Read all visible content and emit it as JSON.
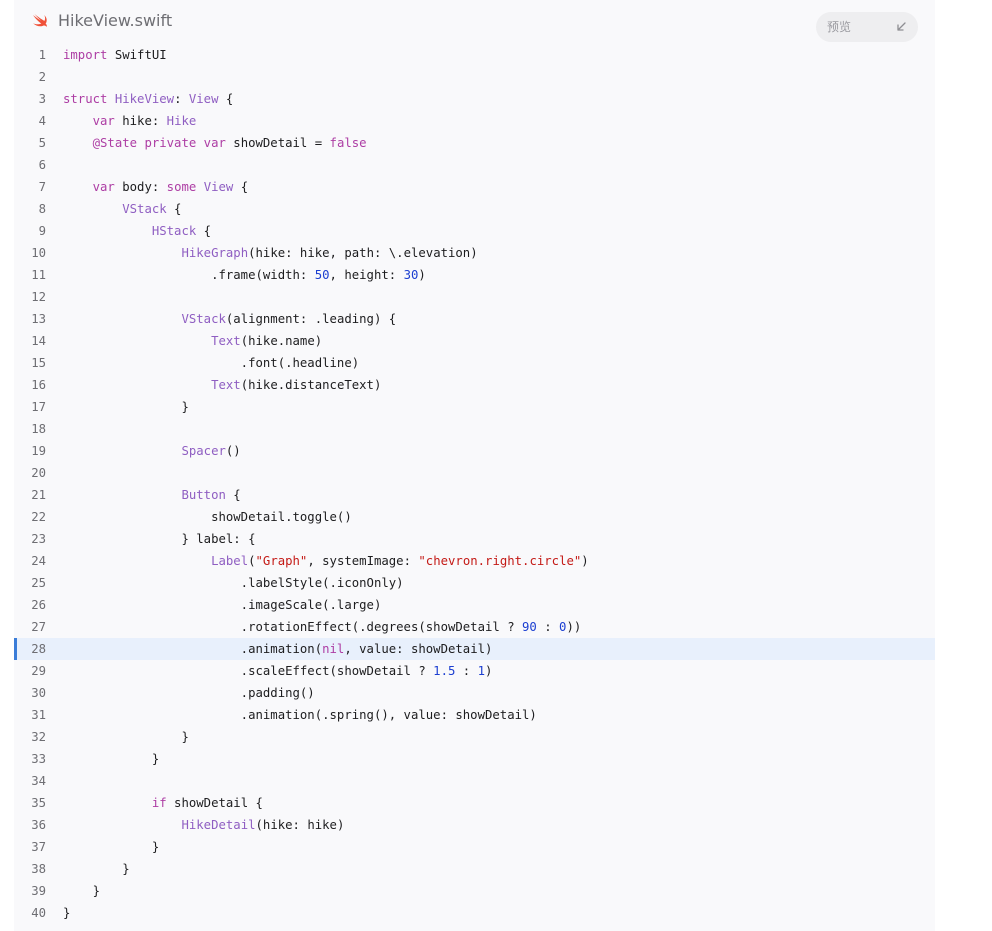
{
  "header": {
    "filename": "HikeView.swift",
    "preview_label": "预览",
    "icons": [
      "swift-logo-icon",
      "collapse-arrow-icon"
    ]
  },
  "colors": {
    "keyword": "#ad3da4",
    "type": "#8f5ec2",
    "number": "#1c3fd1",
    "string": "#c41a16",
    "plain": "#1d1d1f",
    "highlight_bg": "#e8f0fc",
    "highlight_bar": "#3b7dd8",
    "swift_orange": "#f05138"
  },
  "code": {
    "highlighted_line": 28,
    "lines": [
      [
        [
          "k",
          "import"
        ],
        [
          "p",
          " SwiftUI"
        ]
      ],
      [],
      [
        [
          "k",
          "struct"
        ],
        [
          "p",
          " "
        ],
        [
          "t",
          "HikeView"
        ],
        [
          "p",
          ": "
        ],
        [
          "t",
          "View"
        ],
        [
          "p",
          " {"
        ]
      ],
      [
        [
          "p",
          "    "
        ],
        [
          "k",
          "var"
        ],
        [
          "p",
          " hike: "
        ],
        [
          "t",
          "Hike"
        ]
      ],
      [
        [
          "p",
          "    "
        ],
        [
          "k",
          "@State private var"
        ],
        [
          "p",
          " showDetail = "
        ],
        [
          "k",
          "false"
        ]
      ],
      [],
      [
        [
          "p",
          "    "
        ],
        [
          "k",
          "var"
        ],
        [
          "p",
          " body: "
        ],
        [
          "k",
          "some"
        ],
        [
          "p",
          " "
        ],
        [
          "t",
          "View"
        ],
        [
          "p",
          " {"
        ]
      ],
      [
        [
          "p",
          "        "
        ],
        [
          "t",
          "VStack"
        ],
        [
          "p",
          " {"
        ]
      ],
      [
        [
          "p",
          "            "
        ],
        [
          "t",
          "HStack"
        ],
        [
          "p",
          " {"
        ]
      ],
      [
        [
          "p",
          "                "
        ],
        [
          "t",
          "HikeGraph"
        ],
        [
          "p",
          "(hike: hike, path: \\.elevation)"
        ]
      ],
      [
        [
          "p",
          "                    .frame(width: "
        ],
        [
          "n",
          "50"
        ],
        [
          "p",
          ", height: "
        ],
        [
          "n",
          "30"
        ],
        [
          "p",
          ")"
        ]
      ],
      [],
      [
        [
          "p",
          "                "
        ],
        [
          "t",
          "VStack"
        ],
        [
          "p",
          "(alignment: .leading) {"
        ]
      ],
      [
        [
          "p",
          "                    "
        ],
        [
          "t",
          "Text"
        ],
        [
          "p",
          "(hike.name)"
        ]
      ],
      [
        [
          "p",
          "                        .font(.headline)"
        ]
      ],
      [
        [
          "p",
          "                    "
        ],
        [
          "t",
          "Text"
        ],
        [
          "p",
          "(hike.distanceText)"
        ]
      ],
      [
        [
          "p",
          "                }"
        ]
      ],
      [],
      [
        [
          "p",
          "                "
        ],
        [
          "t",
          "Spacer"
        ],
        [
          "p",
          "()"
        ]
      ],
      [],
      [
        [
          "p",
          "                "
        ],
        [
          "t",
          "Button"
        ],
        [
          "p",
          " {"
        ]
      ],
      [
        [
          "p",
          "                    showDetail.toggle()"
        ]
      ],
      [
        [
          "p",
          "                } label: {"
        ]
      ],
      [
        [
          "p",
          "                    "
        ],
        [
          "t",
          "Label"
        ],
        [
          "p",
          "("
        ],
        [
          "s",
          "\"Graph\""
        ],
        [
          "p",
          ", systemImage: "
        ],
        [
          "s",
          "\"chevron.right.circle\""
        ],
        [
          "p",
          ")"
        ]
      ],
      [
        [
          "p",
          "                        .labelStyle(.iconOnly)"
        ]
      ],
      [
        [
          "p",
          "                        .imageScale(.large)"
        ]
      ],
      [
        [
          "p",
          "                        .rotationEffect(.degrees(showDetail ? "
        ],
        [
          "n",
          "90"
        ],
        [
          "p",
          " : "
        ],
        [
          "n",
          "0"
        ],
        [
          "p",
          "))"
        ]
      ],
      [
        [
          "p",
          "                        .animation("
        ],
        [
          "k",
          "nil"
        ],
        [
          "p",
          ", value: showDetail)"
        ]
      ],
      [
        [
          "p",
          "                        .scaleEffect(showDetail ? "
        ],
        [
          "n",
          "1.5"
        ],
        [
          "p",
          " : "
        ],
        [
          "n",
          "1"
        ],
        [
          "p",
          ")"
        ]
      ],
      [
        [
          "p",
          "                        .padding()"
        ]
      ],
      [
        [
          "p",
          "                        .animation(.spring(), value: showDetail)"
        ]
      ],
      [
        [
          "p",
          "                }"
        ]
      ],
      [
        [
          "p",
          "            }"
        ]
      ],
      [],
      [
        [
          "p",
          "            "
        ],
        [
          "k",
          "if"
        ],
        [
          "p",
          " showDetail {"
        ]
      ],
      [
        [
          "p",
          "                "
        ],
        [
          "t",
          "HikeDetail"
        ],
        [
          "p",
          "(hike: hike)"
        ]
      ],
      [
        [
          "p",
          "            }"
        ]
      ],
      [
        [
          "p",
          "        }"
        ]
      ],
      [
        [
          "p",
          "    }"
        ]
      ],
      [
        [
          "p",
          "}"
        ]
      ]
    ]
  }
}
